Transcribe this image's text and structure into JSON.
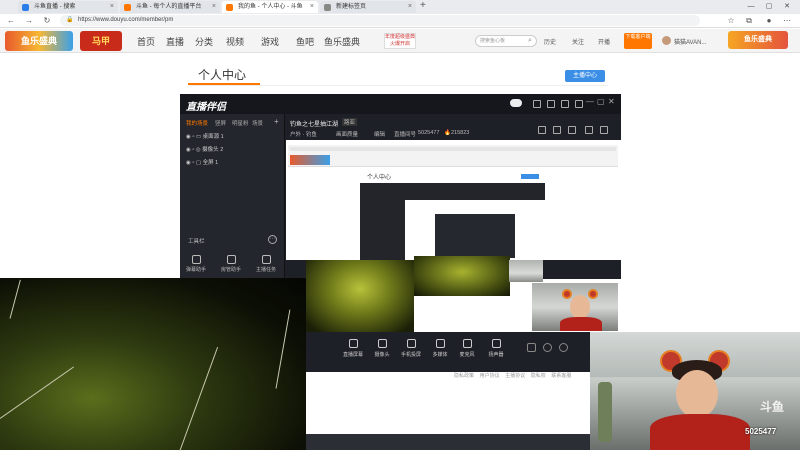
{
  "browser": {
    "tabs": [
      {
        "label": "斗鱼直播 - 搜索",
        "color": "#2b7de9"
      },
      {
        "label": "斗鱼 - 每个人的直播平台",
        "color": "#f70"
      },
      {
        "label": "我的鱼 - 个人中心 - 斗鱼",
        "color": "#f70"
      },
      {
        "label": "新建标签页",
        "color": "#888"
      }
    ],
    "url": "https://www.douyu.com/member/pm",
    "new_tab": "+"
  },
  "site": {
    "logo_text": "鱼乐盛典",
    "logo2_text": "马甲",
    "nav": [
      "首页",
      "直播",
      "分类",
      "视频",
      "游戏",
      "鱼吧",
      "鱼乐盛典"
    ],
    "promo": "年度超级盛典 火爆开启",
    "search_placeholder": "搜索鱼心板",
    "links": [
      "历史",
      "关注",
      "开播"
    ],
    "download": "下载客户端",
    "user": "猫猫AVAN...",
    "banner": "鱼乐盛典"
  },
  "page": {
    "title": "个人中心",
    "streamer_button": "主播中心"
  },
  "app": {
    "logo": "直播伴侣",
    "left_tabs": [
      "我的场景",
      "竖屏",
      "明星粉",
      "场景"
    ],
    "sources": [
      {
        "label": "桌面源 1"
      },
      {
        "label": "摄像头 2"
      },
      {
        "label": "全屏 1"
      }
    ],
    "tool_label": "工具栏",
    "tools": [
      "弹幕助手",
      "房管助手",
      "主播任务"
    ],
    "room_title": "钓鱼之七星抽江湖",
    "room_tag": "路亚",
    "category": "户外 · 钓鱼",
    "quality": "画面质量",
    "edit": "编辑",
    "room_label": "直播间号",
    "room_no": "5025477",
    "hot": "215823",
    "bottom_tools": [
      "直播屏幕",
      "摄像头",
      "手机投屏",
      "多媒体",
      "麦克风",
      "扬声器"
    ],
    "footer_links": [
      "隐私政策",
      "用户协议",
      "主播协议",
      "隐私权",
      "联系客服"
    ]
  },
  "nested": {
    "title": "个人中心"
  },
  "overlay": {
    "room_id": "5025477",
    "watermark": "斗鱼"
  }
}
